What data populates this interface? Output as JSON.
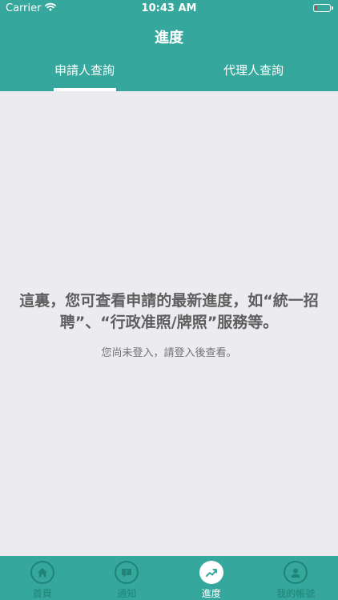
{
  "status_bar": {
    "carrier": "Carrier",
    "time": "10:43 AM",
    "battery_level": 0.16
  },
  "header": {
    "title": "進度",
    "tabs": [
      {
        "label": "申請人查詢",
        "active": true
      },
      {
        "label": "代理人查詢",
        "active": false
      }
    ]
  },
  "content": {
    "message": "這裏，您可查看申請的最新進度，如“統一招聘”、“行政准照/牌照”服務等。",
    "sub_message": "您尚未登入，請登入後查看。"
  },
  "tabbar": {
    "items": [
      {
        "label": "首頁",
        "icon": "home-icon",
        "active": false
      },
      {
        "label": "通知",
        "icon": "notification-icon",
        "active": false
      },
      {
        "label": "進度",
        "icon": "progress-icon",
        "active": true
      },
      {
        "label": "我的帳號",
        "icon": "account-icon",
        "active": false
      }
    ]
  },
  "colors": {
    "brand": "#35a79c",
    "tab_icon": "#208378",
    "background": "#ecebf0",
    "battery_low": "#e23a36"
  }
}
